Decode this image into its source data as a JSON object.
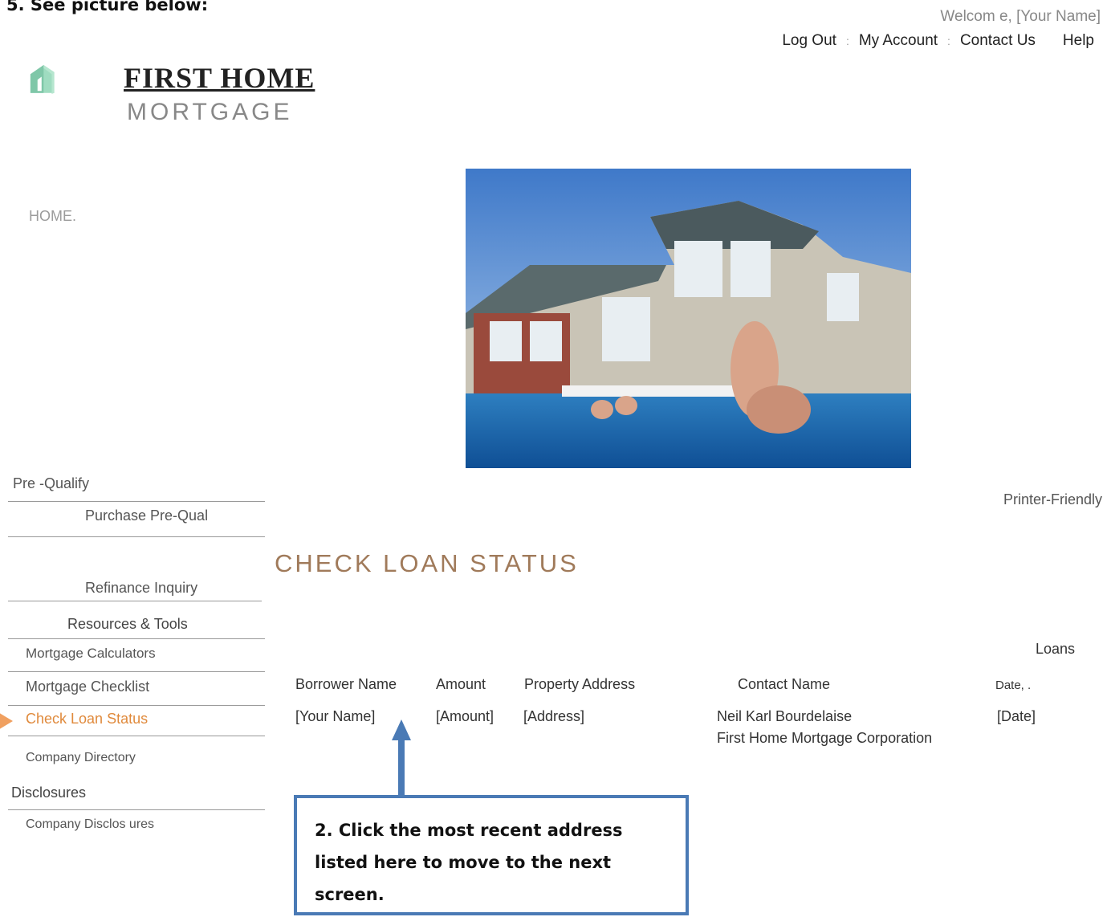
{
  "step_heading": "5.   See picture below:",
  "header": {
    "welcome": "Welcom e,  [Your Name]",
    "links": [
      "Log  Out",
      "My Account",
      "Contact Us",
      "Help"
    ],
    "separator": ":"
  },
  "logo": {
    "title": "FIRST  HOME",
    "subtitle": "MORTGAGE"
  },
  "home_link": "HOME.",
  "printer_friendly": "Printer-Friendly",
  "page_title": "CHECK  LOAN  STATUS",
  "sidebar": {
    "prequalify": "Pre -Qualify",
    "purchase": "Purchase  Pre-Qual",
    "refinance": "Refinance Inquiry",
    "resources": "Resources   & Tools",
    "calculators": "Mortgage   Calculators",
    "checklist": "Mortgage    Checklist",
    "check_status": "Check  Loan  Status",
    "directory": "Company    Directory",
    "disclosures": "Disclosures",
    "company_disclosures": "Company    Disclos ures"
  },
  "table": {
    "loans_label": "Loans",
    "headers": {
      "borrower": "Borrower   Name",
      "amount": "Amount",
      "address": "Property   Address",
      "contact": "Contact Name",
      "date": "Date,  ."
    },
    "row": {
      "borrower": "[Your   Name]",
      "amount": "[Amount]",
      "address": "[Address]",
      "contact_name": "Neil Karl Bourdelaise",
      "contact_company": "First  Home  Mortgage  Corporation",
      "date": "[Date]"
    }
  },
  "callout": "2. Click the most recent address listed here to move to the next screen.",
  "colors": {
    "accent_title": "#a07a5a",
    "callout_border": "#4a7ab5",
    "highlight_arrow": "#f0a060",
    "logo_green": "#8fd3b4"
  }
}
